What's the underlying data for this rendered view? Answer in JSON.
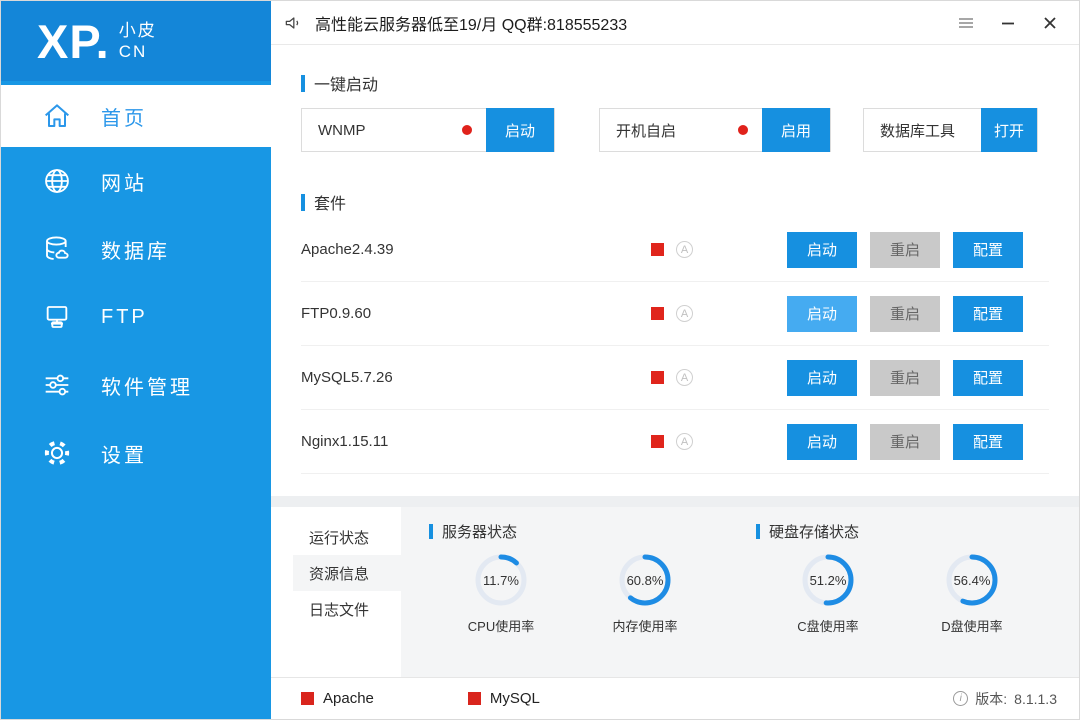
{
  "logo": {
    "brand": "XP.",
    "sub_line1": "小皮",
    "sub_line2": "CN"
  },
  "topbar": {
    "announcement": "高性能云服务器低至19/月 QQ群:818555233"
  },
  "sidebar": {
    "items": [
      {
        "label": "首页",
        "icon": "home-icon",
        "active": true
      },
      {
        "label": "网站",
        "icon": "globe-icon",
        "active": false
      },
      {
        "label": "数据库",
        "icon": "database-icon",
        "active": false
      },
      {
        "label": "FTP",
        "icon": "network-icon",
        "active": false
      },
      {
        "label": "软件管理",
        "icon": "sliders-icon",
        "active": false
      },
      {
        "label": "设置",
        "icon": "gear-icon",
        "active": false
      }
    ]
  },
  "quick_start": {
    "title": "一键启动",
    "items": [
      {
        "label": "WNMP",
        "status_dot": true,
        "button": "启动"
      },
      {
        "label": "开机自启",
        "status_dot": true,
        "button": "启用"
      },
      {
        "label": "数据库工具",
        "status_dot": false,
        "button": "打开"
      }
    ]
  },
  "suite": {
    "title": "套件",
    "rows": [
      {
        "name": "Apache2.4.39",
        "start": "启动",
        "restart": "重启",
        "config": "配置"
      },
      {
        "name": "FTP0.9.60",
        "start": "启动",
        "restart": "重启",
        "config": "配置"
      },
      {
        "name": "MySQL5.7.26",
        "start": "启动",
        "restart": "重启",
        "config": "配置"
      },
      {
        "name": "Nginx1.15.11",
        "start": "启动",
        "restart": "重启",
        "config": "配置"
      }
    ],
    "auto_badge": "A"
  },
  "status_panel": {
    "tabs": [
      {
        "label": "运行状态",
        "active": false
      },
      {
        "label": "资源信息",
        "active": true
      },
      {
        "label": "日志文件",
        "active": false
      }
    ],
    "server_group_title": "服务器状态",
    "disk_group_title": "硬盘存储状态",
    "gauges": [
      {
        "label": "CPU使用率",
        "value": "11.7%",
        "pct": 11.7
      },
      {
        "label": "内存使用率",
        "value": "60.8%",
        "pct": 60.8
      },
      {
        "label": "C盘使用率",
        "value": "51.2%",
        "pct": 51.2
      },
      {
        "label": "D盘使用率",
        "value": "56.4%",
        "pct": 56.4
      }
    ]
  },
  "footer": {
    "legends": [
      {
        "label": "Apache"
      },
      {
        "label": "MySQL"
      }
    ],
    "info_icon": "i",
    "version_label": "版本:",
    "version": "8.1.1.3"
  },
  "colors": {
    "sidebar_blue": "#1897e4",
    "logo_band_blue": "#1486d8",
    "primary_blue": "#1690e0",
    "light_blue": "#45abf1",
    "status_red": "#e0251c",
    "gray_button": "#c9c9c9",
    "gauge_arc": "#1e8ce4",
    "gauge_track": "#e3e9f2",
    "panel_gray": "#f4f5f6"
  }
}
